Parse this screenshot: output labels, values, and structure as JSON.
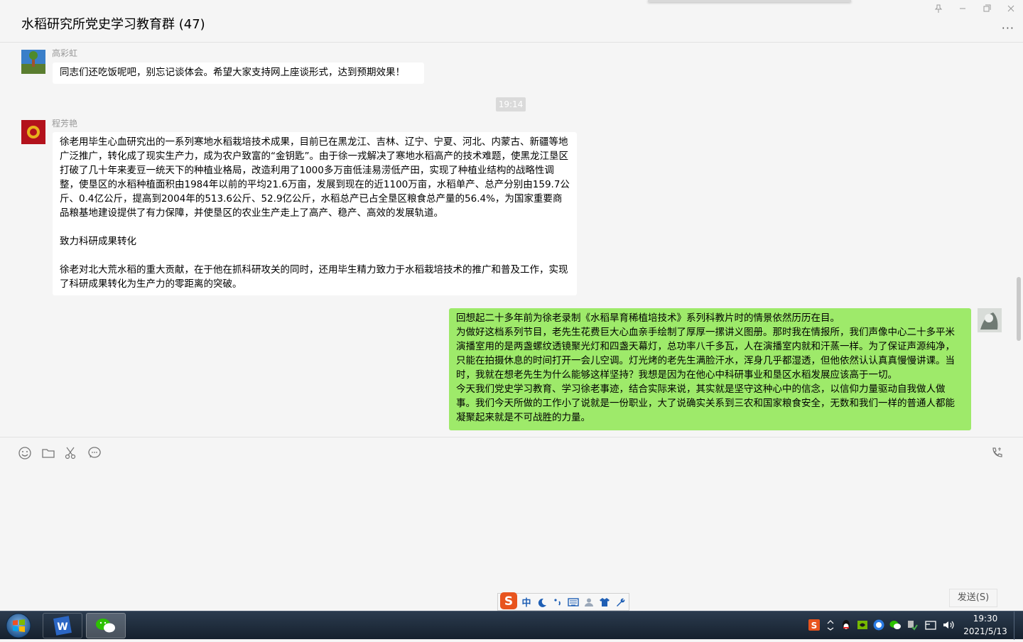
{
  "window": {
    "title": "水稻研究所党史学习教育群 (47)",
    "controls": [
      "pin-icon",
      "minimize-icon",
      "maximize-icon",
      "close-icon"
    ],
    "more_label": "···"
  },
  "messages": [
    {
      "sender": "高彩虹",
      "direction": "in",
      "text": "同志们还吃饭呢吧，别忘记谈体会。希望大家支持网上座谈形式，达到预期效果！"
    },
    {
      "time_divider": "19:14"
    },
    {
      "sender": "程芳艳",
      "direction": "in",
      "text": "徐老用毕生心血研究出的一系列寒地水稻栽培技术成果，目前已在黑龙江、吉林、辽宁、宁夏、河北、内蒙古、新疆等地广泛推广，转化成了现实生产力，成为农户致富的“金钥匙”。由于徐一戎解决了寒地水稻高产的技术难题，使黑龙江垦区打破了几十年来麦豆一统天下的种植业格局，改造利用了1000多万亩低洼易涝低产田，实现了种植业结构的战略性调整，使垦区的水稻种植面积由1984年以前的平均21.6万亩，发展到现在的近1100万亩，水稻单产、总产分别由159.7公斤、0.4亿公斤，提高到2004年的513.6公斤、52.9亿公斤，水稻总产已占全垦区粮食总产量的56.4%，为国家重要商品粮基地建设提供了有力保障，并使垦区的农业生产走上了高产、稳产、高效的发展轨道。\n\n致力科研成果转化\n\n徐老对北大荒水稻的重大贡献，在于他在抓科研攻关的同时，还用毕生精力致力于水稻栽培技术的推广和普及工作，实现了科研成果转化为生产力的零距离的突破。"
    },
    {
      "sender": "",
      "direction": "out",
      "text": "回想起二十多年前为徐老录制《水稻旱育稀植培技术》系列科教片时的情景依然历历在目。\n为做好这档系列节目，老先生花费巨大心血亲手绘制了厚厚一摞讲义图册。那时我在情报所，我们声像中心二十多平米演播室用的是两盏螺纹透镜聚光灯和四盏天幕灯，总功率八千多瓦，人在演播室内就和汗蒸一样。为了保证声源纯净，只能在拍摄休息的时间打开一会儿空调。灯光烤的老先生满脸汗水，浑身几乎都湿透，但他依然认认真真慢慢讲课。当时，我就在想老先生为什么能够这样坚持？我想是因为在他心中科研事业和垦区水稻发展应该高于一切。\n今天我们党史学习教育、学习徐老事迹，结合实际来说，其实就是坚守这种心中的信念，以信仰力量驱动自我做人做事。我们今天所做的工作小了说就是一份职业，大了说确实关系到三农和国家粮食安全，无数和我们一样的普通人都能凝聚起来就是不可战胜的力量。"
    }
  ],
  "toolbar": {
    "icons": [
      "emoji-icon",
      "folder-icon",
      "scissors-icon",
      "chat-history-icon",
      "voice-call-icon"
    ]
  },
  "input": {
    "send_label": "发送(S)"
  },
  "ime": {
    "mode_label": "中",
    "icons": [
      "sogou-logo-icon",
      "moon-icon",
      "punctuation-icon",
      "keyboard-icon",
      "user-icon",
      "skin-shirt-icon",
      "wrench-icon"
    ]
  },
  "taskbar": {
    "time": "19:30",
    "date": "2021/5/13",
    "colors": {
      "wechat_green": "#9eea6a",
      "send_green": "#07c160"
    }
  }
}
